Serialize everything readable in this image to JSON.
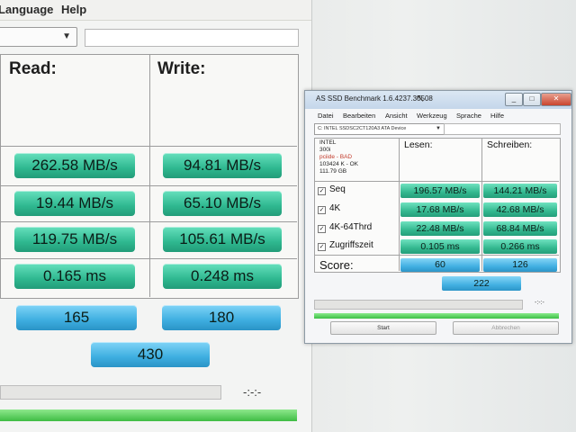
{
  "left_window": {
    "menu": [
      "Language",
      "Help"
    ],
    "headers": {
      "read": "Read:",
      "write": "Write:"
    },
    "rows": [
      {
        "read": "262.58 MB/s",
        "write": "94.81 MB/s"
      },
      {
        "read": "19.44 MB/s",
        "write": "65.10 MB/s"
      },
      {
        "read": "119.75 MB/s",
        "write": "105.61 MB/s"
      },
      {
        "read": "0.165 ms",
        "write": "0.248 ms"
      }
    ],
    "score": {
      "read": "165",
      "write": "180",
      "total": "430"
    },
    "time": "-:-:-"
  },
  "right_window": {
    "title": "AS SSD Benchmark 1.6.4237.30508",
    "menu": [
      "Datei",
      "Bearbeiten",
      "Ansicht",
      "Werkzeug",
      "Sprache",
      "Hilfe"
    ],
    "drive": "C: INTEL SSDSC2CT120A3 ATA Device",
    "info": [
      "INTEL",
      "300i",
      "pciide - BAD",
      "103424 K - OK",
      "111.79 GB"
    ],
    "headers": {
      "read": "Lesen:",
      "write": "Schreiben:"
    },
    "rows": [
      {
        "label": "Seq",
        "read": "196.57 MB/s",
        "write": "144.21 MB/s"
      },
      {
        "label": "4K",
        "read": "17.68 MB/s",
        "write": "42.68 MB/s"
      },
      {
        "label": "4K-64Thrd",
        "read": "22.48 MB/s",
        "write": "68.84 MB/s"
      },
      {
        "label": "Zugriffszeit",
        "read": "0.105 ms",
        "write": "0.266 ms"
      }
    ],
    "score_label": "Score:",
    "score": {
      "read": "60",
      "write": "126",
      "total": "222"
    },
    "time": "-:-:-",
    "buttons": {
      "start": "Start",
      "cancel": "Abbrechen"
    },
    "window_buttons": {
      "minimize": "_",
      "maximize": "□",
      "close": "✕"
    }
  }
}
